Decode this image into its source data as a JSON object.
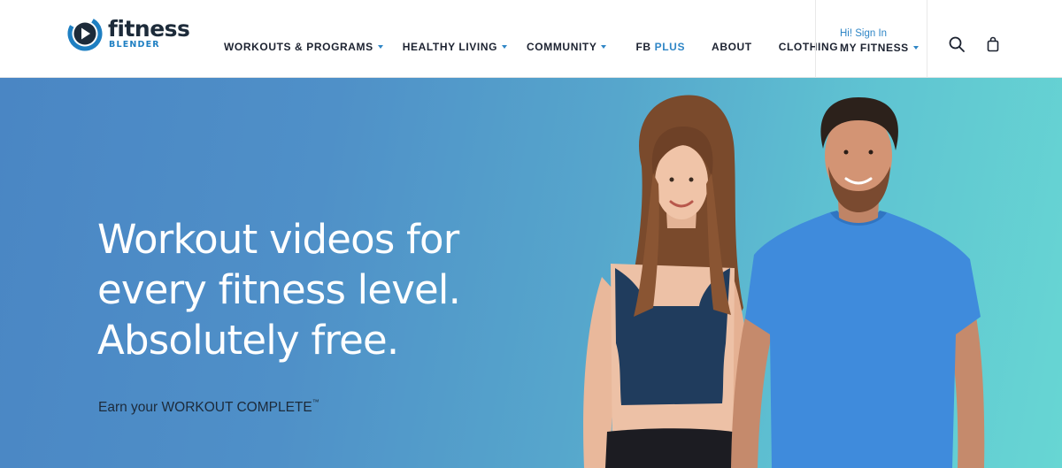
{
  "brand": {
    "name": "fitness",
    "sub": "BLENDER",
    "colors": {
      "navy": "#1d2b3a",
      "blue": "#2f86c6"
    }
  },
  "nav": {
    "items": [
      {
        "label": "WORKOUTS & PROGRAMS",
        "dropdown": true
      },
      {
        "label": "HEALTHY LIVING",
        "dropdown": true
      },
      {
        "label": "COMMUNITY",
        "dropdown": true
      },
      {
        "label": "FB",
        "accent": "PLUS",
        "dropdown": false
      },
      {
        "label": "ABOUT",
        "dropdown": false
      },
      {
        "label": "CLOTHING",
        "dropdown": false
      }
    ]
  },
  "account": {
    "greeting": "Hi! Sign In",
    "label": "MY FITNESS"
  },
  "icons": {
    "search": "search-icon",
    "cart": "shopping-bag-icon"
  },
  "hero": {
    "headline": [
      "Workout videos for",
      "every fitness level.",
      "Absolutely free."
    ],
    "tagline": "Earn your WORKOUT COMPLETE",
    "tagline_mark": "™"
  }
}
